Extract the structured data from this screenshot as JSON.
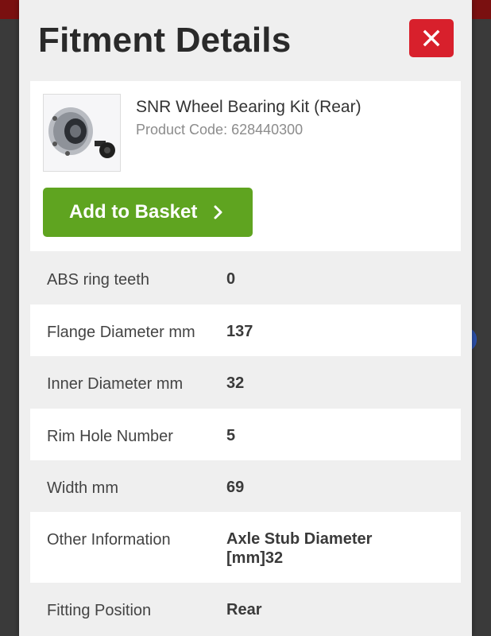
{
  "modal": {
    "title": "Fitment Details",
    "close_icon": "close-icon"
  },
  "product": {
    "name": "SNR Wheel Bearing Kit (Rear)",
    "code_label": "Product Code: 628440300",
    "image_icon": "wheel-bearing-image",
    "add_label": "Add to Basket"
  },
  "specs": [
    {
      "label": "ABS ring teeth",
      "value": "0"
    },
    {
      "label": "Flange Diameter mm",
      "value": "137"
    },
    {
      "label": "Inner Diameter mm",
      "value": "32"
    },
    {
      "label": "Rim Hole Number",
      "value": "5"
    },
    {
      "label": "Width mm",
      "value": "69"
    },
    {
      "label": "Other Information",
      "value": "Axle Stub Diameter [mm]32"
    },
    {
      "label": "Fitting Position",
      "value": "Rear"
    }
  ],
  "colors": {
    "close": "#d8202c",
    "add_button": "#5fa420",
    "header_bar": "#7a1010"
  }
}
